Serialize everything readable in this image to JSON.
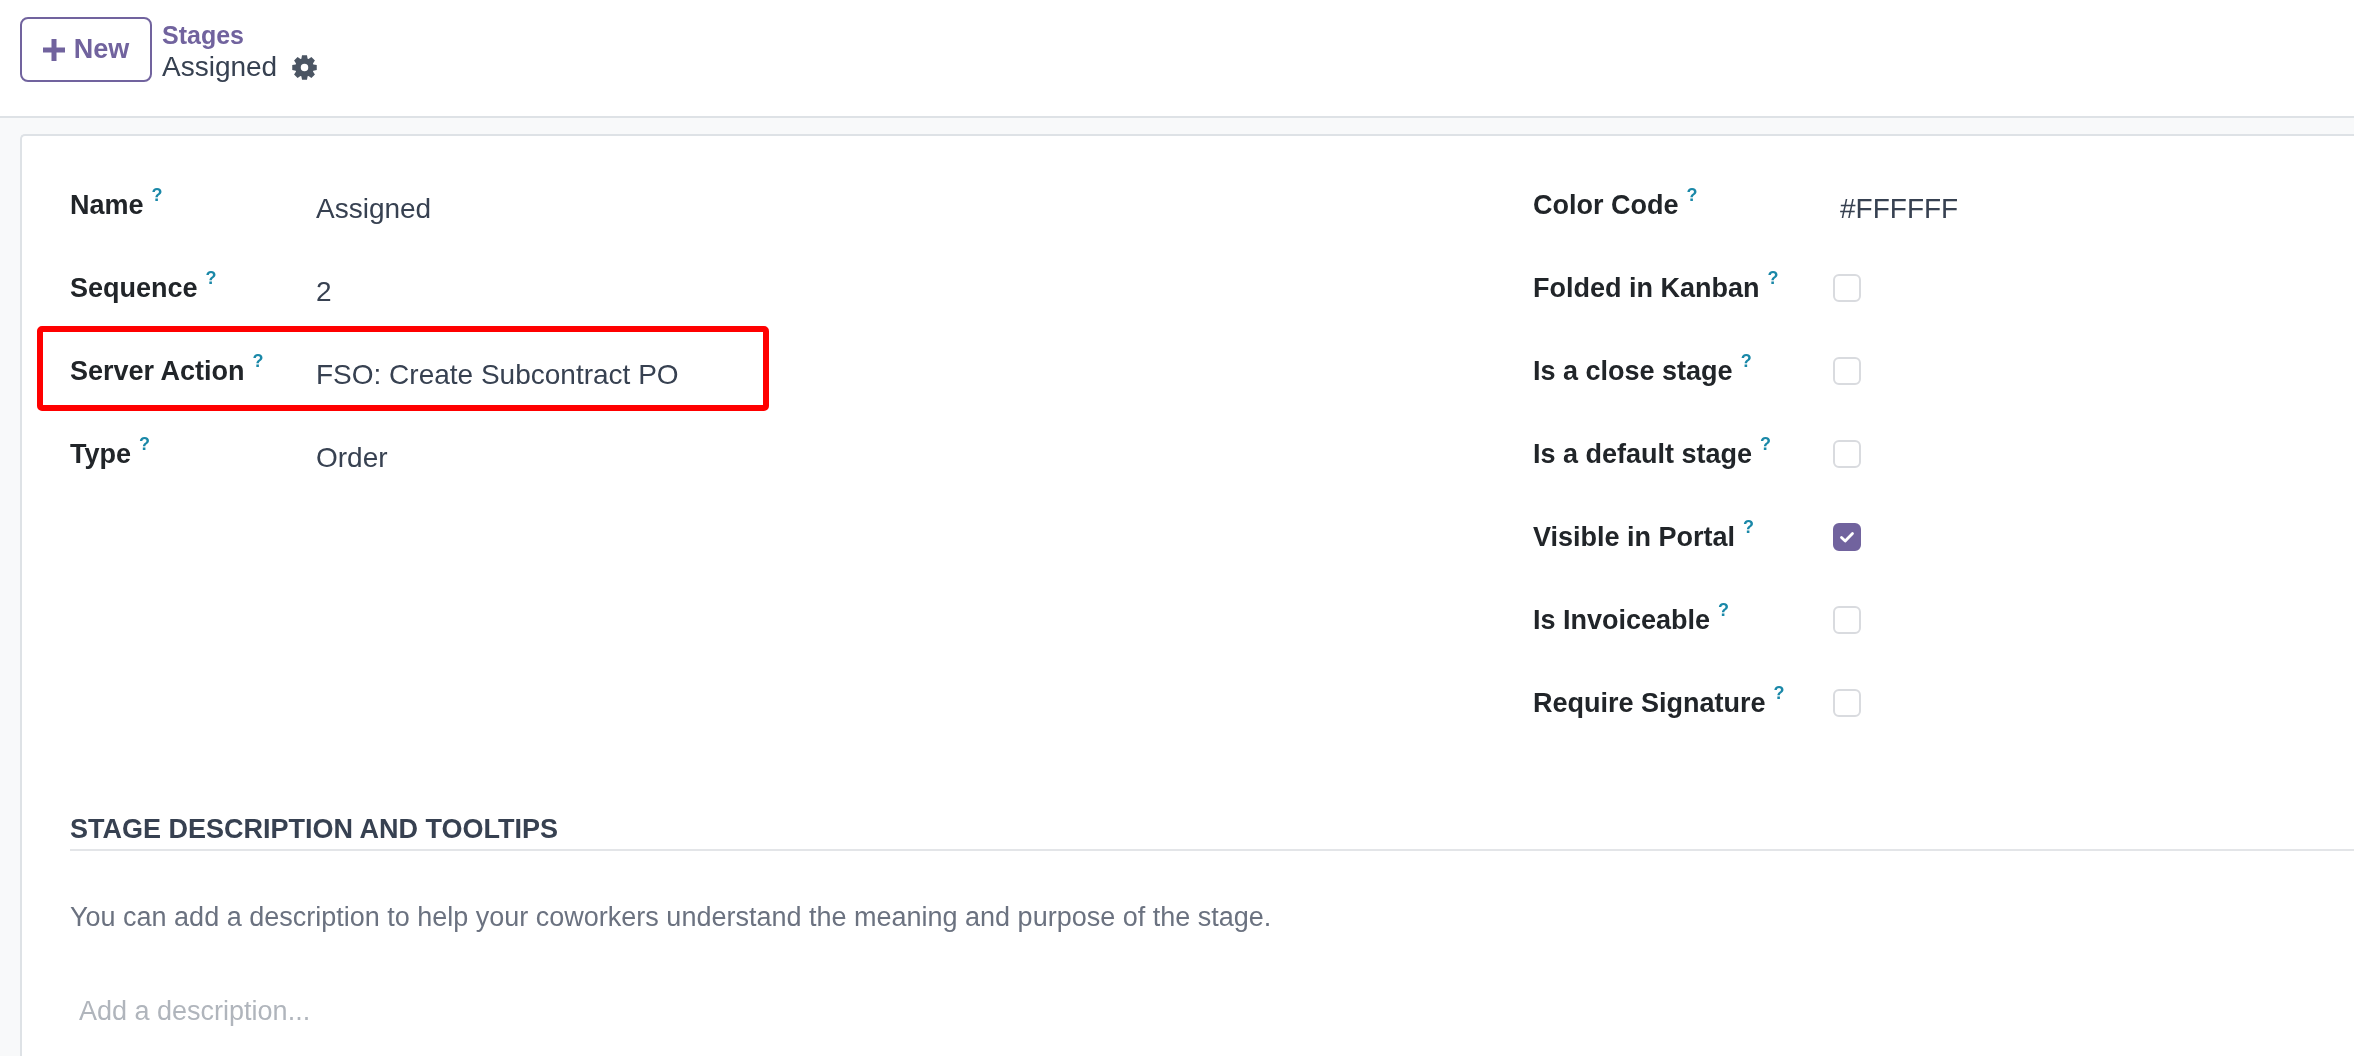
{
  "control_panel": {
    "new_button": {
      "label": "New"
    },
    "breadcrumb": {
      "parent": "Stages",
      "current": "Assigned"
    }
  },
  "form": {
    "left_fields": [
      {
        "label": "Name",
        "help": "?",
        "value": "Assigned",
        "highlighted": false
      },
      {
        "label": "Sequence",
        "help": "?",
        "value": "2",
        "highlighted": false
      },
      {
        "label": "Server Action",
        "help": "?",
        "value": "FSO: Create Subcontract PO",
        "highlighted": true
      },
      {
        "label": "Type",
        "help": "?",
        "value": "Order",
        "highlighted": false
      }
    ],
    "right_fields": [
      {
        "kind": "text",
        "label": "Color Code",
        "help": "?",
        "value": "#FFFFFF"
      },
      {
        "kind": "checkbox",
        "label": "Folded in Kanban",
        "help": "?",
        "checked": false
      },
      {
        "kind": "checkbox",
        "label": "Is a close stage",
        "help": "?",
        "checked": false
      },
      {
        "kind": "checkbox",
        "label": "Is a default stage",
        "help": "?",
        "checked": false
      },
      {
        "kind": "checkbox",
        "label": "Visible in Portal",
        "help": "?",
        "checked": true
      },
      {
        "kind": "checkbox",
        "label": "Is Invoiceable",
        "help": "?",
        "checked": false
      },
      {
        "kind": "checkbox",
        "label": "Require Signature",
        "help": "?",
        "checked": false
      }
    ],
    "description_section": {
      "title": "STAGE DESCRIPTION AND TOOLTIPS",
      "hint": "You can add a description to help your coworkers understand the meaning and purpose of the stage.",
      "description": {
        "placeholder": "Add a description..."
      }
    }
  }
}
